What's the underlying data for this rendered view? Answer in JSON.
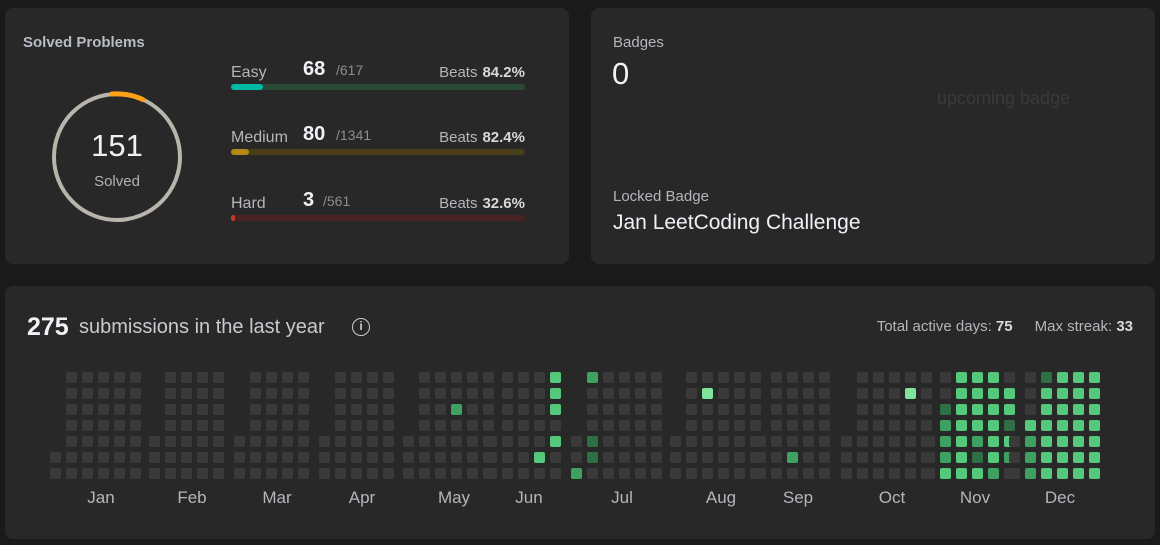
{
  "solved": {
    "title": "Solved Problems",
    "total": "151",
    "subtitle": "Solved",
    "difficulties": [
      {
        "name": "Easy",
        "solved": "68",
        "total": "/617",
        "beats_label": "Beats",
        "beats": "84.2%",
        "fraction": 0.11,
        "color": "#00b8a3",
        "track": "#2a4a36"
      },
      {
        "name": "Medium",
        "solved": "80",
        "total": "/1341",
        "beats_label": "Beats",
        "beats": "82.4%",
        "fraction": 0.06,
        "color": "#b58a14",
        "track": "#4a3f18"
      },
      {
        "name": "Hard",
        "solved": "3",
        "total": "/561",
        "beats_label": "Beats",
        "beats": "32.6%",
        "fraction": 0.005,
        "color": "#c0392b",
        "track": "#4a2222"
      }
    ]
  },
  "badges": {
    "label": "Badges",
    "count": "0",
    "upcoming_alt": "upcoming badge",
    "locked_label": "Locked Badge",
    "locked_name": "Jan LeetCoding Challenge"
  },
  "heatmap": {
    "submissions_count": "275",
    "submissions_text": "submissions in the last year",
    "info_icon": "info-icon",
    "active_days_label": "Total active days:",
    "active_days": "75",
    "max_streak_label": "Max streak:",
    "max_streak": "33",
    "months": [
      "Jan",
      "Feb",
      "Mar",
      "Apr",
      "May",
      "Jun",
      "Jul",
      "Aug",
      "Sep",
      "Oct",
      "Nov",
      "Dec"
    ]
  }
}
